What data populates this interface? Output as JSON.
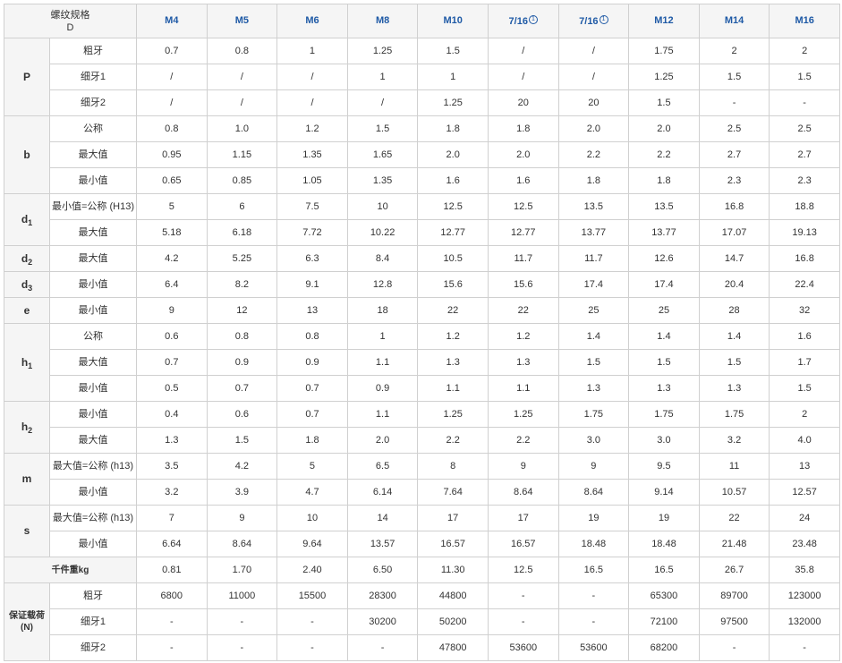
{
  "corner": {
    "line1": "螺纹规格",
    "line2": "D"
  },
  "columns": [
    {
      "label": "M4",
      "note": ""
    },
    {
      "label": "M5",
      "note": ""
    },
    {
      "label": "M6",
      "note": ""
    },
    {
      "label": "M8",
      "note": ""
    },
    {
      "label": "M10",
      "note": ""
    },
    {
      "label": "7/16",
      "note": "1"
    },
    {
      "label": "7/16",
      "note": "1"
    },
    {
      "label": "M12",
      "note": ""
    },
    {
      "label": "M14",
      "note": ""
    },
    {
      "label": "M16",
      "note": ""
    }
  ],
  "groups": [
    {
      "label": "P",
      "sub": "",
      "style": "grp",
      "rows": [
        {
          "label": "粗牙",
          "values": [
            "0.7",
            "0.8",
            "1",
            "1.25",
            "1.5",
            "/",
            "/",
            "1.75",
            "2",
            "2"
          ]
        },
        {
          "label": "细牙1",
          "values": [
            "/",
            "/",
            "/",
            "1",
            "1",
            "/",
            "/",
            "1.25",
            "1.5",
            "1.5"
          ]
        },
        {
          "label": "细牙2",
          "values": [
            "/",
            "/",
            "/",
            "/",
            "1.25",
            "20",
            "20",
            "1.5",
            "-",
            "-"
          ]
        }
      ]
    },
    {
      "label": "b",
      "sub": "",
      "style": "grp",
      "rows": [
        {
          "label": "公称",
          "values": [
            "0.8",
            "1.0",
            "1.2",
            "1.5",
            "1.8",
            "1.8",
            "2.0",
            "2.0",
            "2.5",
            "2.5"
          ]
        },
        {
          "label": "最大值",
          "values": [
            "0.95",
            "1.15",
            "1.35",
            "1.65",
            "2.0",
            "2.0",
            "2.2",
            "2.2",
            "2.7",
            "2.7"
          ]
        },
        {
          "label": "最小值",
          "values": [
            "0.65",
            "0.85",
            "1.05",
            "1.35",
            "1.6",
            "1.6",
            "1.8",
            "1.8",
            "2.3",
            "2.3"
          ]
        }
      ]
    },
    {
      "label": "d",
      "sub": "1",
      "style": "grp",
      "rows": [
        {
          "label": "最小值=公称 (H13)",
          "values": [
            "5",
            "6",
            "7.5",
            "10",
            "12.5",
            "12.5",
            "13.5",
            "13.5",
            "16.8",
            "18.8"
          ]
        },
        {
          "label": "最大值",
          "values": [
            "5.18",
            "6.18",
            "7.72",
            "10.22",
            "12.77",
            "12.77",
            "13.77",
            "13.77",
            "17.07",
            "19.13"
          ]
        }
      ]
    },
    {
      "label": "d",
      "sub": "2",
      "style": "grp",
      "rows": [
        {
          "label": "最大值",
          "values": [
            "4.2",
            "5.25",
            "6.3",
            "8.4",
            "10.5",
            "11.7",
            "11.7",
            "12.6",
            "14.7",
            "16.8"
          ]
        }
      ]
    },
    {
      "label": "d",
      "sub": "3",
      "style": "grp",
      "rows": [
        {
          "label": "最小值",
          "values": [
            "6.4",
            "8.2",
            "9.1",
            "12.8",
            "15.6",
            "15.6",
            "17.4",
            "17.4",
            "20.4",
            "22.4"
          ]
        }
      ]
    },
    {
      "label": "e",
      "sub": "",
      "style": "grp",
      "rows": [
        {
          "label": "最小值",
          "values": [
            "9",
            "12",
            "13",
            "18",
            "22",
            "22",
            "25",
            "25",
            "28",
            "32"
          ]
        }
      ]
    },
    {
      "label": "h",
      "sub": "1",
      "style": "grp",
      "rows": [
        {
          "label": "公称",
          "values": [
            "0.6",
            "0.8",
            "0.8",
            "1",
            "1.2",
            "1.2",
            "1.4",
            "1.4",
            "1.4",
            "1.6"
          ]
        },
        {
          "label": "最大值",
          "values": [
            "0.7",
            "0.9",
            "0.9",
            "1.1",
            "1.3",
            "1.3",
            "1.5",
            "1.5",
            "1.5",
            "1.7"
          ]
        },
        {
          "label": "最小值",
          "values": [
            "0.5",
            "0.7",
            "0.7",
            "0.9",
            "1.1",
            "1.1",
            "1.3",
            "1.3",
            "1.3",
            "1.5"
          ]
        }
      ]
    },
    {
      "label": "h",
      "sub": "2",
      "style": "grp",
      "rows": [
        {
          "label": "最小值",
          "values": [
            "0.4",
            "0.6",
            "0.7",
            "1.1",
            "1.25",
            "1.25",
            "1.75",
            "1.75",
            "1.75",
            "2"
          ]
        },
        {
          "label": "最大值",
          "values": [
            "1.3",
            "1.5",
            "1.8",
            "2.0",
            "2.2",
            "2.2",
            "3.0",
            "3.0",
            "3.2",
            "4.0"
          ]
        }
      ]
    },
    {
      "label": "m",
      "sub": "",
      "style": "grp",
      "rows": [
        {
          "label": "最大值=公称 (h13)",
          "values": [
            "3.5",
            "4.2",
            "5",
            "6.5",
            "8",
            "9",
            "9",
            "9.5",
            "11",
            "13"
          ]
        },
        {
          "label": "最小值",
          "values": [
            "3.2",
            "3.9",
            "4.7",
            "6.14",
            "7.64",
            "8.64",
            "8.64",
            "9.14",
            "10.57",
            "12.57"
          ]
        }
      ]
    },
    {
      "label": "s",
      "sub": "",
      "style": "grp",
      "rows": [
        {
          "label": "最大值=公称 (h13)",
          "values": [
            "7",
            "9",
            "10",
            "14",
            "17",
            "17",
            "19",
            "19",
            "22",
            "24"
          ]
        },
        {
          "label": "最小值",
          "values": [
            "6.64",
            "8.64",
            "9.64",
            "13.57",
            "16.57",
            "16.57",
            "18.48",
            "18.48",
            "21.48",
            "23.48"
          ]
        }
      ]
    }
  ],
  "weight_row": {
    "label": "千件重kg",
    "values": [
      "0.81",
      "1.70",
      "2.40",
      "6.50",
      "11.30",
      "12.5",
      "16.5",
      "16.5",
      "26.7",
      "35.8"
    ]
  },
  "load_group": {
    "label": "保证载荷(N)",
    "rows": [
      {
        "label": "粗牙",
        "values": [
          "6800",
          "11000",
          "15500",
          "28300",
          "44800",
          "-",
          "-",
          "65300",
          "89700",
          "123000"
        ]
      },
      {
        "label": "细牙1",
        "values": [
          "-",
          "-",
          "-",
          "30200",
          "50200",
          "-",
          "-",
          "72100",
          "97500",
          "132000"
        ]
      },
      {
        "label": "细牙2",
        "values": [
          "-",
          "-",
          "-",
          "-",
          "47800",
          "53600",
          "53600",
          "68200",
          "-",
          "-"
        ]
      }
    ]
  }
}
